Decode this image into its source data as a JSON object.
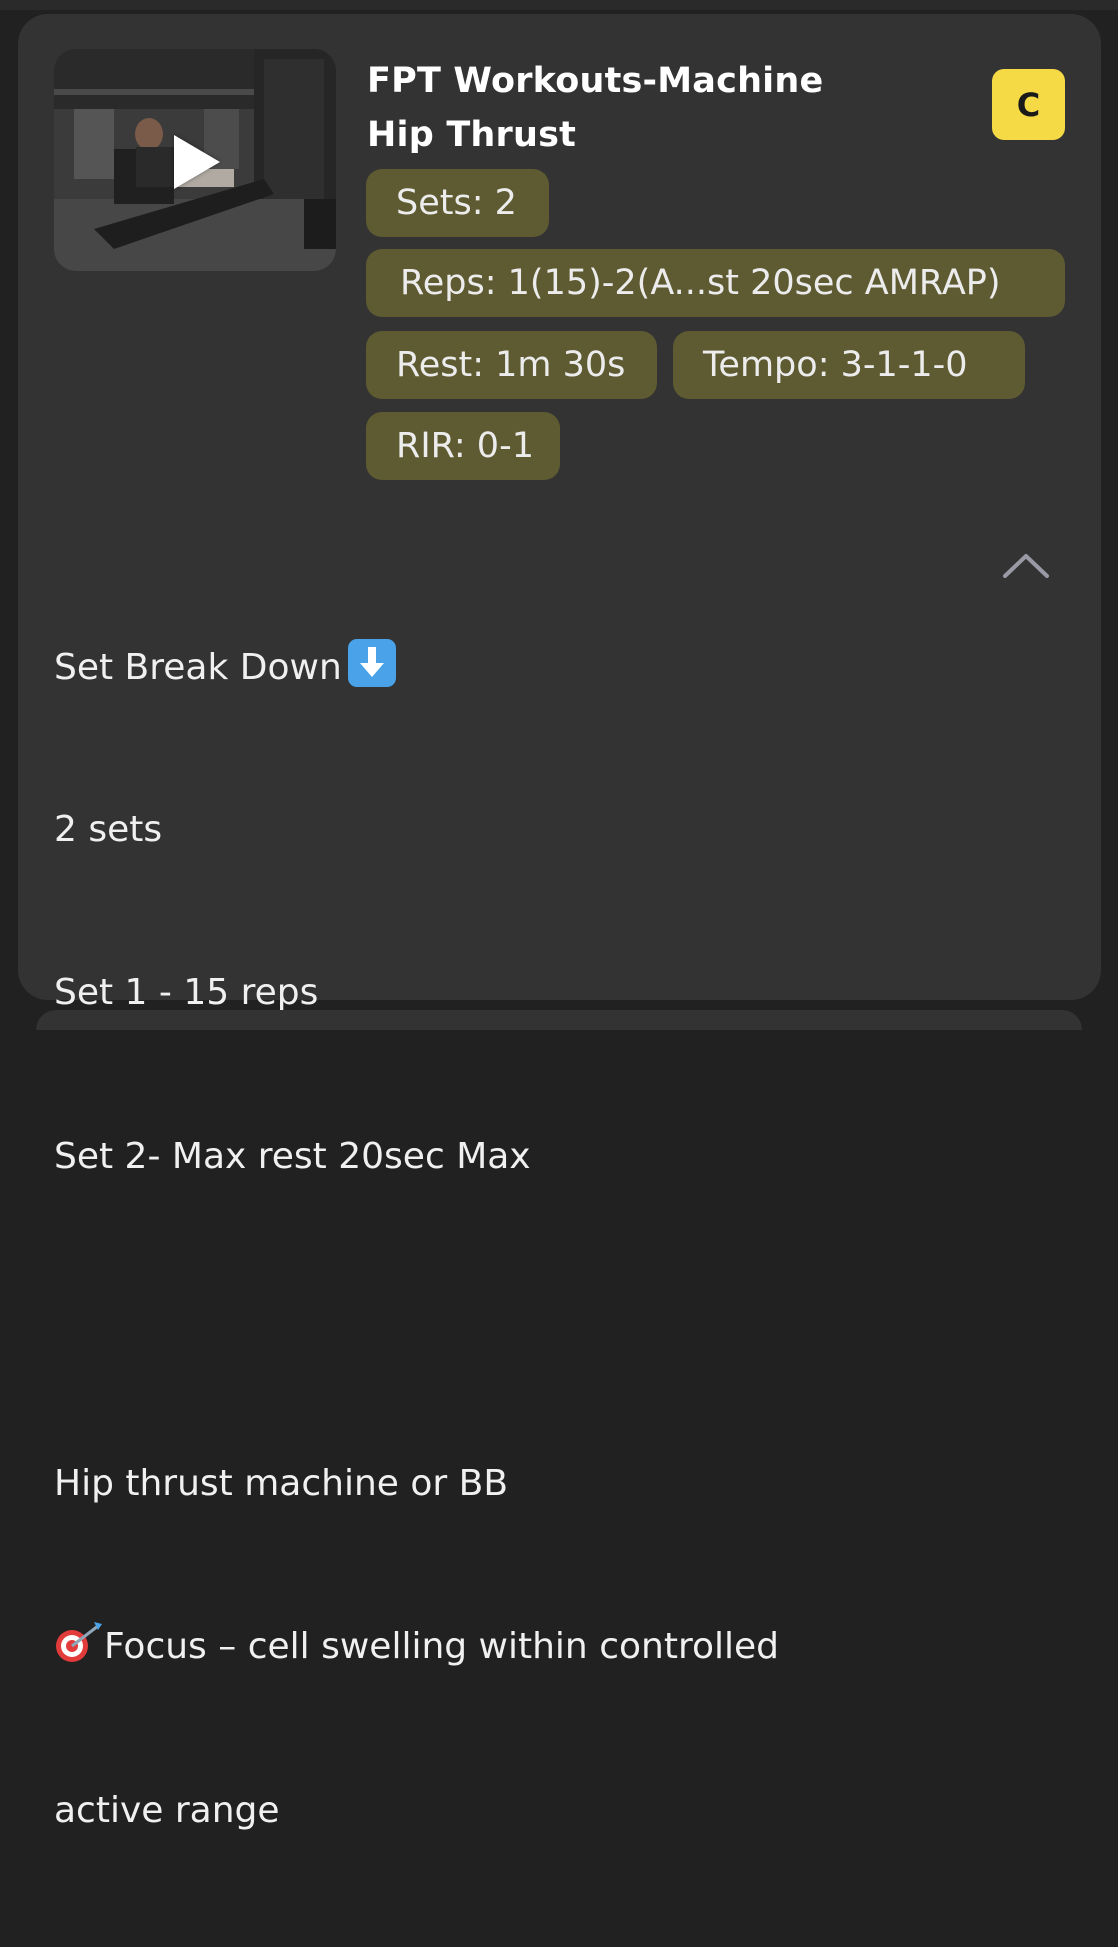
{
  "exercise": {
    "title_line1": "FPT Workouts-Machine",
    "title_line2": "Hip Thrust",
    "badge": "C",
    "badge_color": "#f5d945"
  },
  "pills": {
    "sets": "Sets: 2",
    "reps": "Reps: 1(15)-2(A...st 20sec AMRAP)",
    "rest": "Rest: 1m 30s",
    "tempo": "Tempo: 3-1-1-0",
    "rir": "RIR: 0-1",
    "pill_color": "#5e5a31"
  },
  "notes": {
    "line1": "Set Break Down",
    "line2": "2 sets",
    "line3": "Set 1 - 15 reps",
    "line4": "Set 2- Max rest 20sec Max",
    "line5": "",
    "line6": "Hip thrust machine or BB",
    "line7": "Focus – cell swelling within controlled",
    "line8": "active range"
  },
  "icons": {
    "play": "play-icon",
    "down_arrow": "down-arrow-emoji",
    "target": "target-emoji",
    "collapse": "chevron-up-icon"
  },
  "colors": {
    "card_background": "#333333",
    "page_background": "#212121"
  }
}
